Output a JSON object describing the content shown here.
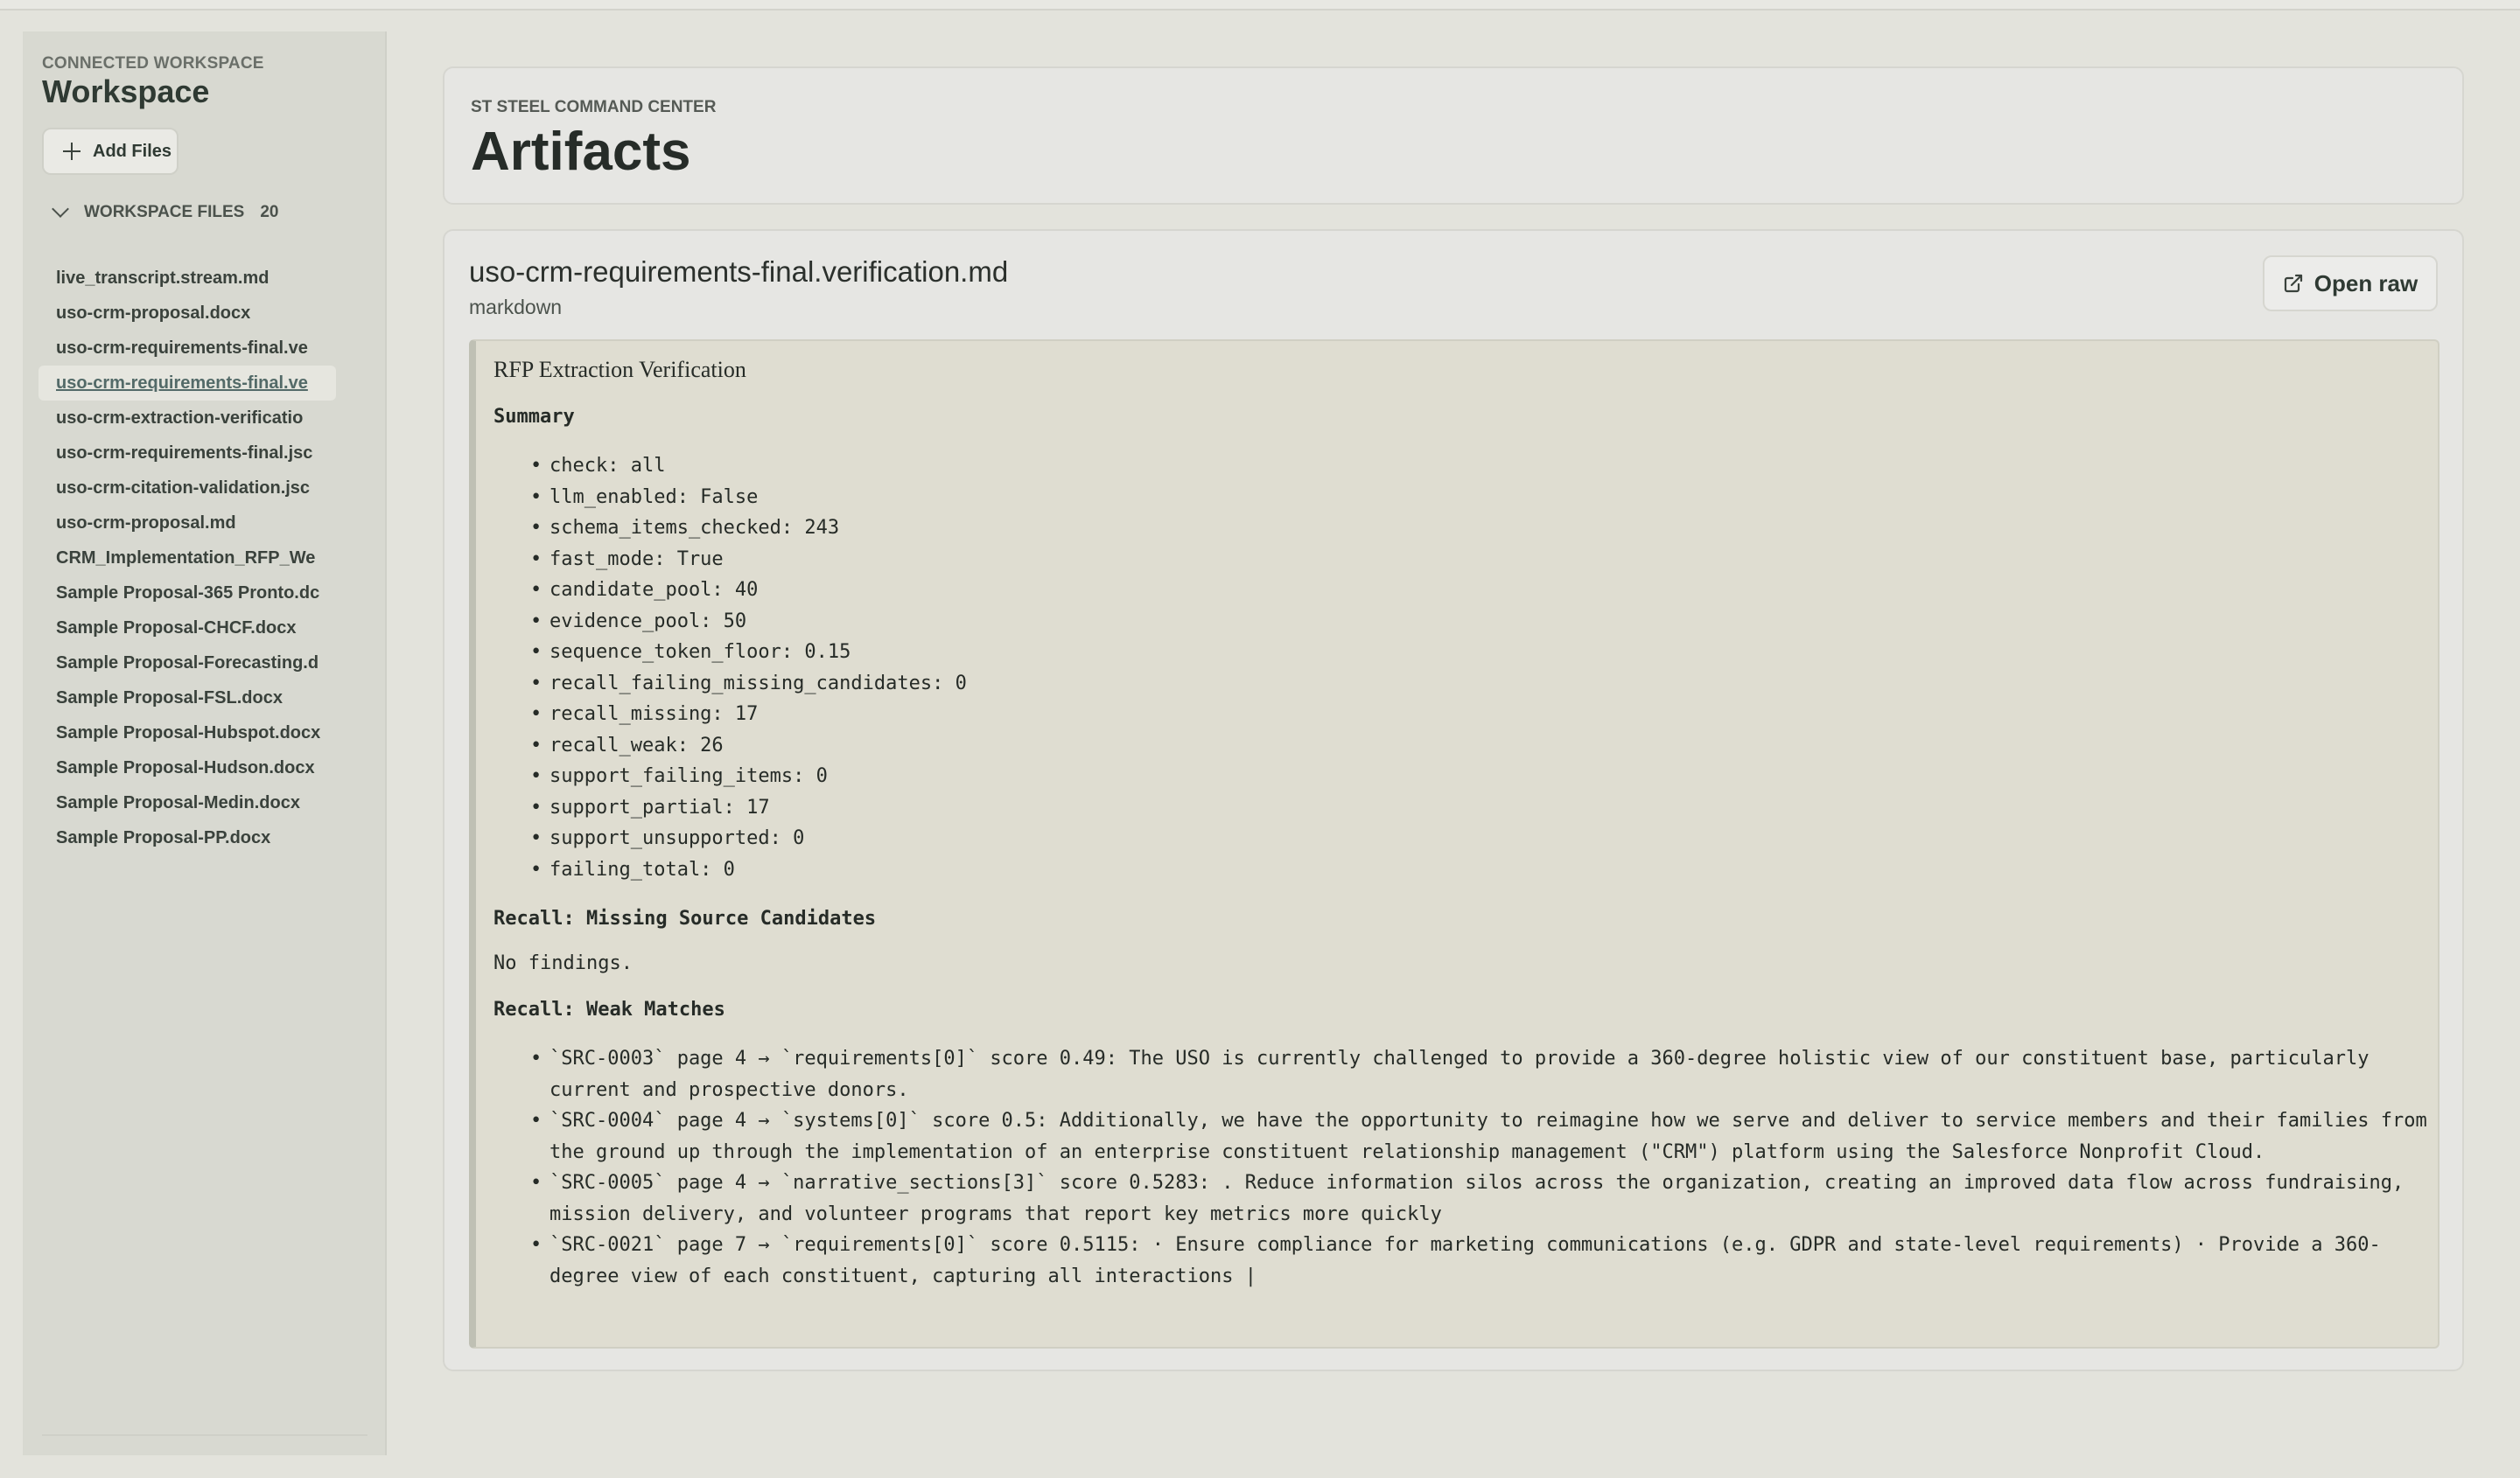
{
  "sidebar": {
    "eyebrow": "CONNECTED WORKSPACE",
    "title": "Workspace",
    "add_files_label": "Add Files",
    "files_header": "WORKSPACE FILES",
    "files_count": "20",
    "files": [
      "live_transcript.stream.md",
      "uso-crm-proposal.docx",
      "uso-crm-requirements-final.ve",
      "uso-crm-requirements-final.ve",
      "uso-crm-extraction-verificatio",
      "uso-crm-requirements-final.jsc",
      "uso-crm-citation-validation.jsc",
      "uso-crm-proposal.md",
      "CRM_Implementation_RFP_We",
      "Sample Proposal-365 Pronto.dc",
      "Sample Proposal-CHCF.docx",
      "Sample Proposal-Forecasting.d",
      "Sample Proposal-FSL.docx",
      "Sample Proposal-Hubspot.docx",
      "Sample Proposal-Hudson.docx",
      "Sample Proposal-Medin.docx",
      "Sample Proposal-PP.docx"
    ],
    "active_index": 3
  },
  "header": {
    "eyebrow": "ST STEEL COMMAND CENTER",
    "title": "Artifacts"
  },
  "document": {
    "filename": "uso-crm-requirements-final.verification.md",
    "type": "markdown",
    "open_raw_label": "Open raw",
    "heading": "RFP Extraction Verification",
    "summary_title": "Summary",
    "summary_items": [
      "check: all",
      "llm_enabled: False",
      "schema_items_checked: 243",
      "fast_mode: True",
      "candidate_pool: 40",
      "evidence_pool: 50",
      "sequence_token_floor: 0.15",
      "recall_failing_missing_candidates: 0",
      "recall_missing: 17",
      "recall_weak: 26",
      "support_failing_items: 0",
      "support_partial: 17",
      "support_unsupported: 0",
      "failing_total: 0"
    ],
    "missing_title": "Recall: Missing Source Candidates",
    "missing_text": "No findings.",
    "weak_title": "Recall: Weak Matches",
    "weak_items": [
      "`SRC-0003` page 4 → `requirements[0]` score 0.49: The USO is currently challenged to provide a 360-degree holistic view of our constituent base, particularly current and prospective donors.",
      "`SRC-0004` page 4 → `systems[0]` score 0.5: Additionally, we have the opportunity to reimagine how we serve and deliver to service members and their families from the ground up through the implementation of an enterprise constituent relationship management (\"CRM\") platform using the Salesforce Nonprofit Cloud.",
      "`SRC-0005` page 4 → `narrative_sections[3]` score 0.5283: . Reduce information silos across the organization, creating an improved data flow across fundraising, mission delivery, and volunteer programs that report key metrics more quickly",
      "`SRC-0021` page 7 → `requirements[0]` score 0.5115: · Ensure compliance for marketing communications (e.g. GDPR and state-level requirements) · Provide a 360-degree view of each constituent, capturing all interactions |"
    ]
  }
}
